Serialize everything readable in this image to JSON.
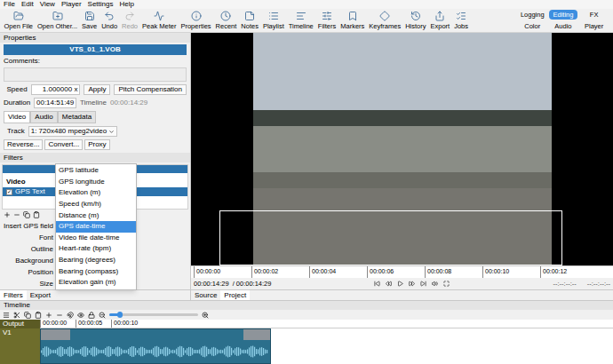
{
  "menu": [
    "File",
    "Edit",
    "View",
    "Player",
    "Settings",
    "Help"
  ],
  "toolbar": [
    {
      "label": "Open File",
      "disabled": false
    },
    {
      "label": "Open Other...",
      "disabled": false
    },
    {
      "label": "Save",
      "disabled": false
    },
    {
      "label": "Undo",
      "disabled": false
    },
    {
      "label": "Redo",
      "disabled": true
    },
    {
      "label": "Peak Meter",
      "disabled": false
    },
    {
      "label": "Properties",
      "disabled": false
    },
    {
      "label": "Recent",
      "disabled": false
    },
    {
      "label": "Notes",
      "disabled": false
    },
    {
      "label": "Playlist",
      "disabled": false
    },
    {
      "label": "Timeline",
      "disabled": false
    },
    {
      "label": "Filters",
      "disabled": false
    },
    {
      "label": "Markers",
      "disabled": false
    },
    {
      "label": "Keyframes",
      "disabled": false
    },
    {
      "label": "History",
      "disabled": false
    },
    {
      "label": "Export",
      "disabled": false
    },
    {
      "label": "Jobs",
      "disabled": false
    }
  ],
  "layouts": [
    {
      "label": "Logging",
      "selected": false
    },
    {
      "label": "Editing",
      "selected": true
    },
    {
      "label": "FX",
      "selected": false
    },
    {
      "label": "Color",
      "selected": false
    },
    {
      "label": "Audio",
      "selected": false
    },
    {
      "label": "Player",
      "selected": false
    }
  ],
  "properties": {
    "title": "Properties",
    "clip": "VTS_01_1.VOB",
    "comments_label": "Comments:",
    "speed_label": "Speed",
    "speed": "1.000000 x",
    "apply": "Apply",
    "pitch": "Pitch Compensation",
    "duration_label": "Duration",
    "duration": "00:14:51:49",
    "timeline_label": "Timeline",
    "timeline": "00:00:14:29",
    "tabs": [
      {
        "label": "Video",
        "selected": true
      },
      {
        "label": "Audio",
        "selected": false
      },
      {
        "label": "Metadata",
        "selected": false
      }
    ],
    "track_label": "Track",
    "track": "1: 720x480 mpeg2video",
    "buttons": [
      "Reverse...",
      "Convert...",
      "Proxy"
    ]
  },
  "filters": {
    "title": "Filters",
    "group": "Video",
    "items": [
      {
        "label": "GPS Text",
        "checked": true,
        "selected": true
      }
    ],
    "fields": [
      {
        "label": "Insert GPS field",
        "kind": "label"
      },
      {
        "label": "Font",
        "kind": "swatch"
      },
      {
        "label": "Outline",
        "kind": "swatch"
      },
      {
        "label": "Background",
        "kind": "swatch"
      },
      {
        "label": "Position",
        "kind": "label"
      },
      {
        "label": "Size",
        "kind": "label"
      }
    ],
    "gps_field_menu": [
      {
        "label": "GPS latitude",
        "selected": false
      },
      {
        "label": "GPS longitude",
        "selected": false
      },
      {
        "label": "Elevation (m)",
        "selected": false
      },
      {
        "label": "Speed (km/h)",
        "selected": false
      },
      {
        "label": "Distance (m)",
        "selected": false
      },
      {
        "label": "GPS date-time",
        "selected": true
      },
      {
        "label": "Video file date-time",
        "selected": false
      },
      {
        "label": "Heart-rate (bpm)",
        "selected": false
      },
      {
        "label": "Bearing (degrees)",
        "selected": false
      },
      {
        "label": "Bearing (compass)",
        "selected": false
      },
      {
        "label": "Elevation gain (m)",
        "selected": false
      }
    ]
  },
  "left_tabs": [
    {
      "label": "Filters",
      "selected": true
    },
    {
      "label": "Export",
      "selected": false
    }
  ],
  "player": {
    "ruler": [
      "00:00:00",
      "00:00:02",
      "00:00:04",
      "00:00:06",
      "00:00:08",
      "00:00:10",
      "00:00:12"
    ],
    "position": "00:00:14:29",
    "duration": "/ 00:00:14:29",
    "in_point": "--:--:--:--",
    "out_point": "--:--:--:--",
    "tabs": [
      {
        "label": "Source",
        "selected": false
      },
      {
        "label": "Project",
        "selected": true
      }
    ]
  },
  "timeline": {
    "title": "Timeline",
    "zoom": {
      "level": 0.12
    },
    "tracks": [
      "Output",
      "V1"
    ],
    "ruler": [
      "00:00:00",
      "00:00:05",
      "00:00:10"
    ]
  }
}
